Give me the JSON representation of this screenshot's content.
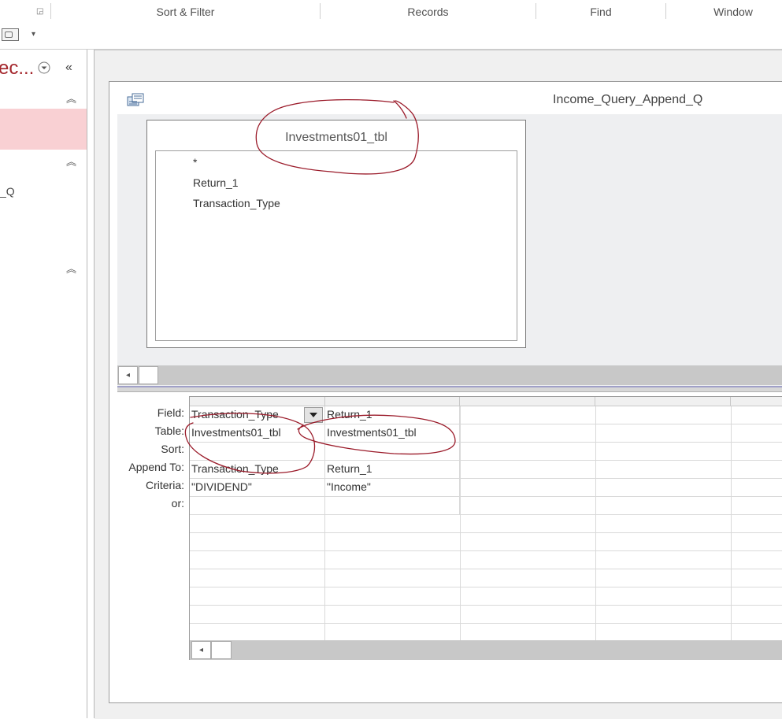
{
  "ribbon": {
    "groups": [
      "Sort & Filter",
      "Records",
      "Find",
      "Window"
    ],
    "dialog_launcher_icon": "dialog-launcher-icon"
  },
  "quick_access": {
    "icon": "attachment-icon",
    "dropdown_icon": "customize-dropdown-icon"
  },
  "nav_pane": {
    "title": "ec...",
    "collapse_glyph": "«",
    "section_chevron": "⌃",
    "query_item_label": "_Q",
    "selected_color": "#f9d0d3"
  },
  "query_window": {
    "title": "Income_Query_Append_Q",
    "icon": "query-design-icon"
  },
  "table_box": {
    "title": "Investments01_tbl",
    "fields": [
      "*",
      "Return_1",
      "Transaction_Type"
    ]
  },
  "design_grid": {
    "row_labels": [
      "Field:",
      "Table:",
      "Sort:",
      "Append To:",
      "Criteria:",
      "or:"
    ],
    "columns": [
      {
        "field": "Transaction_Type",
        "table": "Investments01_tbl",
        "sort": "",
        "append_to": "Transaction_Type",
        "criteria": "\"DIVIDEND\"",
        "or": ""
      },
      {
        "field": "Return_1",
        "table": "Investments01_tbl",
        "sort": "",
        "append_to": "Return_1",
        "criteria": "\"Income\"",
        "or": ""
      },
      {
        "field": "",
        "table": "",
        "sort": "",
        "append_to": "",
        "criteria": "",
        "or": ""
      },
      {
        "field": "",
        "table": "",
        "sort": "",
        "append_to": "",
        "criteria": "",
        "or": ""
      },
      {
        "field": "",
        "table": "",
        "sort": "",
        "append_to": "",
        "criteria": "",
        "or": ""
      }
    ]
  },
  "scrollbar": {
    "left_arrow": "◂"
  },
  "annotation_color": "#9b1b2a"
}
